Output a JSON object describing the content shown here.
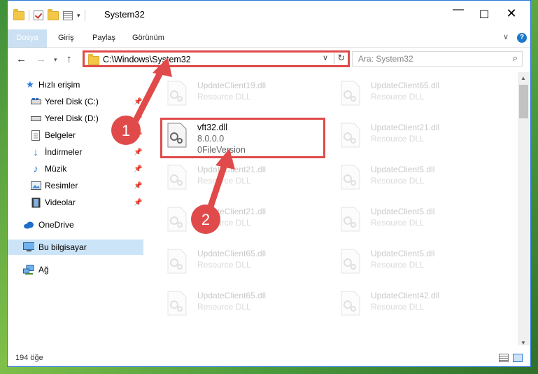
{
  "window": {
    "title": "System32"
  },
  "ribbon": {
    "tabs": [
      {
        "label": "Dosya"
      },
      {
        "label": "Giriş"
      },
      {
        "label": "Paylaş"
      },
      {
        "label": "Görünüm"
      }
    ],
    "help": "?"
  },
  "address": {
    "path": "C:\\Windows\\System32",
    "search_placeholder": "Ara: System32"
  },
  "sidebar": {
    "items": [
      {
        "label": "Hızlı erişim",
        "icon": "star-icon",
        "pinned": false
      },
      {
        "label": "Yerel Disk (C:)",
        "icon": "drive-icon",
        "pinned": true
      },
      {
        "label": "Yerel Disk (D:)",
        "icon": "drive-icon",
        "pinned": true
      },
      {
        "label": "Belgeler",
        "icon": "document-icon",
        "pinned": true
      },
      {
        "label": "İndirmeler",
        "icon": "download-icon",
        "pinned": true
      },
      {
        "label": "Müzik",
        "icon": "music-icon",
        "pinned": true
      },
      {
        "label": "Resimler",
        "icon": "picture-icon",
        "pinned": true
      },
      {
        "label": "Videolar",
        "icon": "video-icon",
        "pinned": true
      },
      {
        "label": "OneDrive",
        "icon": "cloud-icon",
        "pinned": false
      },
      {
        "label": "Bu bilgisayar",
        "icon": "computer-icon",
        "pinned": false
      },
      {
        "label": "Ağ",
        "icon": "network-icon",
        "pinned": false
      }
    ]
  },
  "files": {
    "highlighted": {
      "name": "vft32.dll",
      "version": "8.0.0.0",
      "desc": "0FileVersion"
    },
    "left": [
      {
        "name": "UpdateClient19.dll",
        "desc": "Resource DLL"
      },
      {
        "name": "UpdateClient21.dll",
        "desc": "Resource DLL"
      },
      {
        "name": "UpdateClient21.dll",
        "desc": "Resource DLL"
      },
      {
        "name": "UpdateClient65.dll",
        "desc": "Resource DLL"
      },
      {
        "name": "UpdateClient65.dll",
        "desc": "Resource DLL"
      }
    ],
    "right": [
      {
        "name": "UpdateClient65.dll",
        "desc": "Resource DLL"
      },
      {
        "name": "UpdateClient21.dll",
        "desc": "Resource DLL"
      },
      {
        "name": "UpdateClient5.dll",
        "desc": "Resource DLL"
      },
      {
        "name": "UpdateClient5.dll",
        "desc": "Resource DLL"
      },
      {
        "name": "UpdateClient5.dll",
        "desc": "Resource DLL"
      },
      {
        "name": "UpdateClient42.dll",
        "desc": "Resource DLL"
      }
    ]
  },
  "status": {
    "count": "194 öğe"
  },
  "annotations": {
    "badge1": "1",
    "badge2": "2",
    "color": "#e04a4a"
  }
}
